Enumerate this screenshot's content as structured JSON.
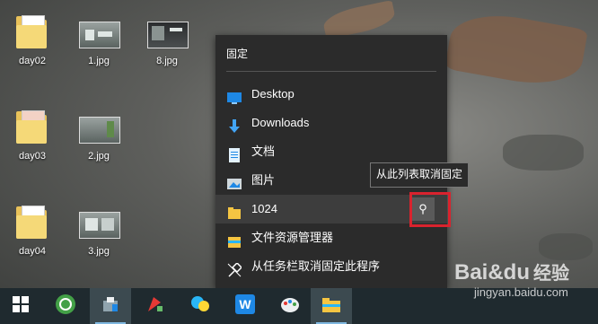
{
  "desktop": {
    "icons": [
      {
        "label": "day02",
        "type": "folder"
      },
      {
        "label": "1.jpg",
        "type": "image"
      },
      {
        "label": "8.jpg",
        "type": "image"
      },
      {
        "label": "day03",
        "type": "folder"
      },
      {
        "label": "2.jpg",
        "type": "image"
      },
      {
        "label": "day04",
        "type": "folder"
      },
      {
        "label": "3.jpg",
        "type": "image"
      }
    ]
  },
  "jumplist": {
    "header": "固定",
    "items": [
      {
        "label": "Desktop",
        "icon": "desktop-icon"
      },
      {
        "label": "Downloads",
        "icon": "download-arrow-icon"
      },
      {
        "label": "文档",
        "icon": "document-icon"
      },
      {
        "label": "图片",
        "icon": "picture-icon"
      },
      {
        "label": "1024",
        "icon": "folder-icon"
      },
      {
        "label": "文件资源管理器",
        "icon": "file-explorer-icon"
      },
      {
        "label": "从任务栏取消固定此程序",
        "icon": "unpin-icon"
      }
    ],
    "tooltip": "从此列表取消固定",
    "pin_glyph": "⚲"
  },
  "taskbar": {
    "buttons": [
      {
        "name": "start-button",
        "icon": "windows-logo-icon"
      },
      {
        "name": "browser-app",
        "icon": "green-circle-arrow-icon"
      },
      {
        "name": "explorer-tool-app",
        "icon": "tool-icon"
      },
      {
        "name": "paint-app",
        "icon": "brush-icon"
      },
      {
        "name": "chat-app",
        "icon": "chat-bubbles-icon"
      },
      {
        "name": "word-app",
        "icon": "w-letter-icon"
      },
      {
        "name": "palette-app",
        "icon": "palette-icon"
      },
      {
        "name": "file-explorer-app",
        "icon": "folder-icon"
      }
    ]
  },
  "watermark": {
    "logo": "Bai&du",
    "cn": "经验",
    "url": "jingyan.baidu.com"
  },
  "colors": {
    "highlight": "#d9232e",
    "menu_bg": "#2b2b2b",
    "taskbar_bg": "#1f2a2f"
  }
}
